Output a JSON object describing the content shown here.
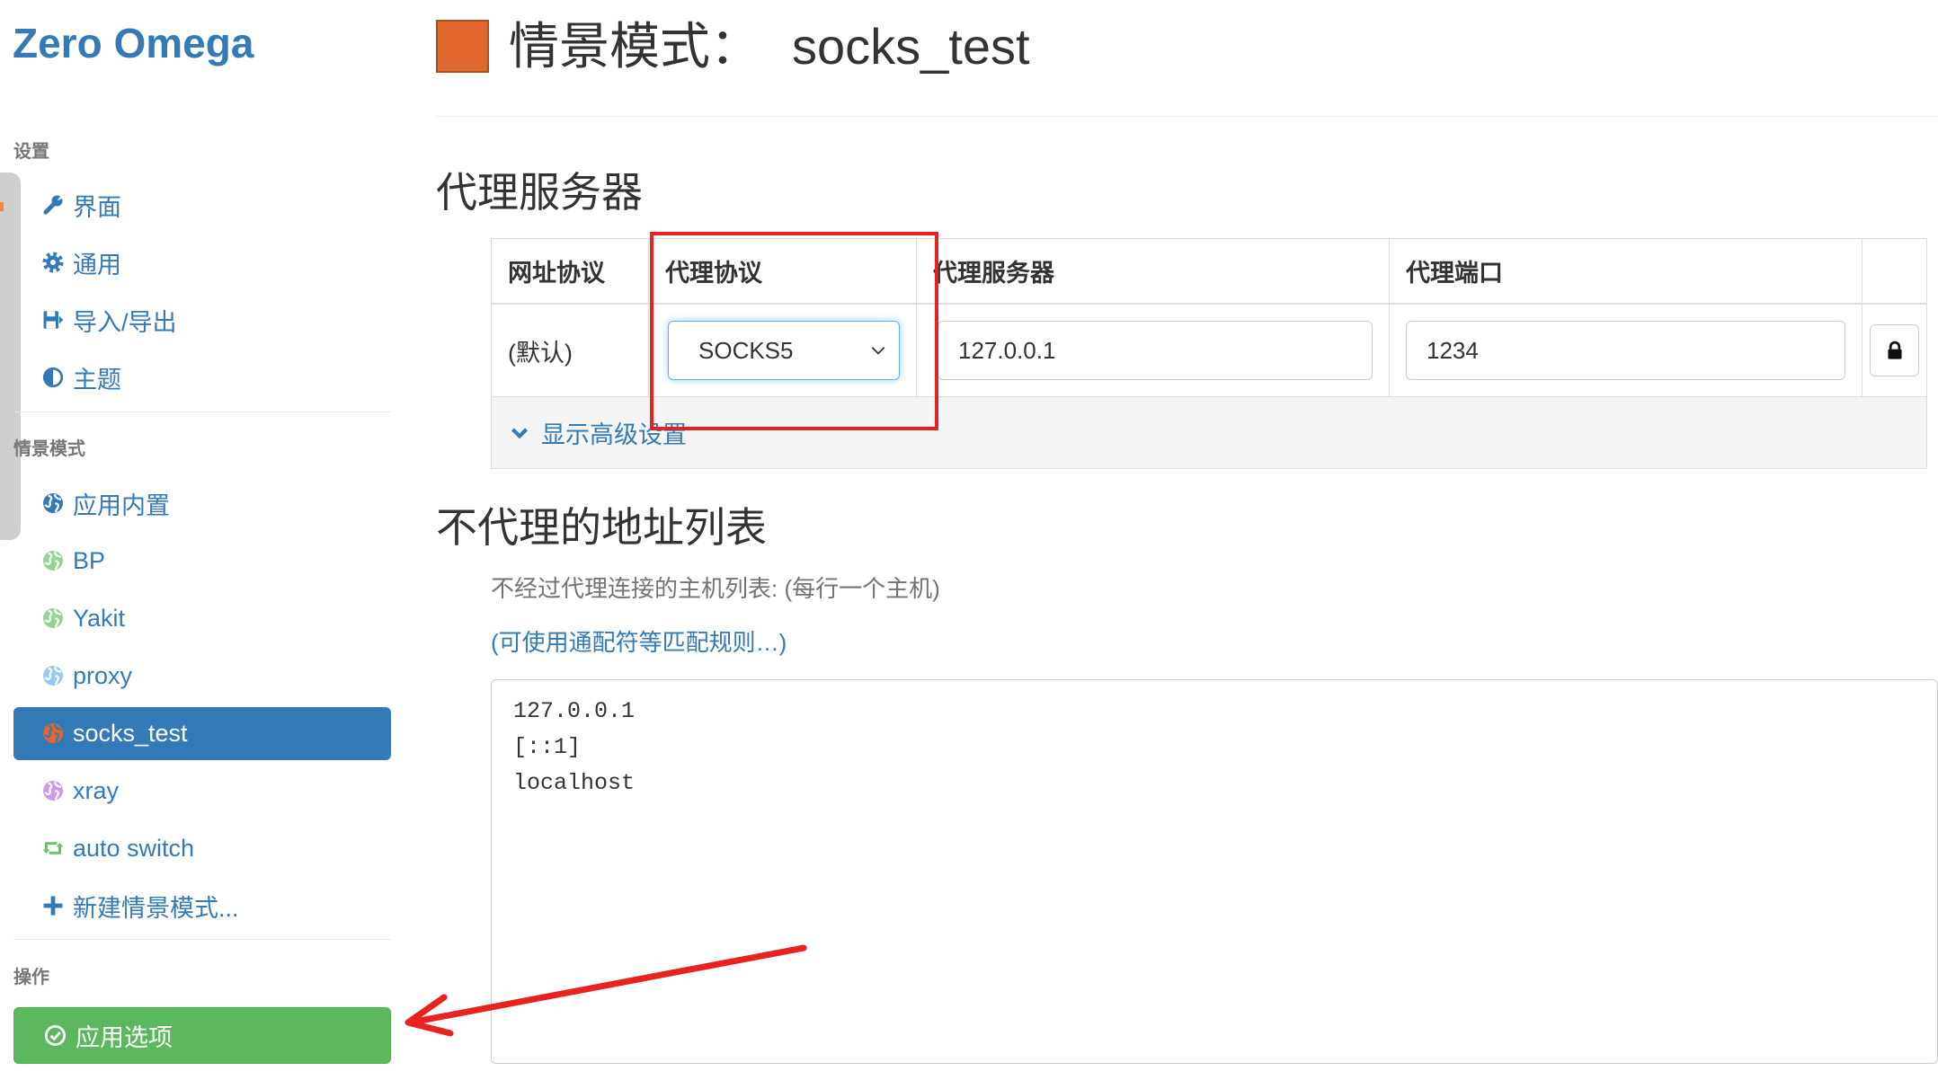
{
  "app": {
    "brand": "Zero Omega"
  },
  "sidebar": {
    "settings_header": "设置",
    "settings_items": [
      {
        "label": "界面",
        "icon": "wrench-icon"
      },
      {
        "label": "通用",
        "icon": "gear-icon"
      },
      {
        "label": "导入/导出",
        "icon": "floppy-disk-icon"
      },
      {
        "label": "主题",
        "icon": "contrast-icon"
      }
    ],
    "profiles_header": "情景模式",
    "profiles": [
      {
        "label": "应用内置",
        "icon": "globe-icon",
        "icon_color": "#337ab7"
      },
      {
        "label": "BP",
        "icon": "globe-icon",
        "icon_color": "#93d393"
      },
      {
        "label": "Yakit",
        "icon": "globe-icon",
        "icon_color": "#93d393"
      },
      {
        "label": "proxy",
        "icon": "globe-icon",
        "icon_color": "#99c9f0"
      },
      {
        "label": "socks_test",
        "icon": "globe-icon",
        "icon_color": "#e2672f",
        "active": true
      },
      {
        "label": "xray",
        "icon": "globe-icon",
        "icon_color": "#c99be8"
      },
      {
        "label": "auto switch",
        "icon": "retweet-icon",
        "icon_color": "#6cc26c"
      }
    ],
    "new_profile": {
      "label": "新建情景模式...",
      "icon": "plus-icon"
    },
    "actions_header": "操作",
    "apply_button": {
      "label": "应用选项",
      "icon": "ok-circle-icon",
      "color": "#5cb85c"
    }
  },
  "page": {
    "title_label": "情景模式：",
    "profile_name": "socks_test",
    "profile_color": "#e2672f",
    "proxy_section_title": "代理服务器",
    "proxy_table": {
      "headers": [
        "网址协议",
        "代理协议",
        "代理服务器",
        "代理端口"
      ],
      "row": {
        "scheme": "(默认)",
        "protocol": "SOCKS5",
        "host": "127.0.0.1",
        "port": "1234"
      }
    },
    "advanced_link": "显示高级设置",
    "bypass_section_title": "不代理的地址列表",
    "bypass_help": "不经过代理连接的主机列表: (每行一个主机)",
    "bypass_rules_link": "(可使用通配符等匹配规则…)",
    "bypass_list": "127.0.0.1\n[::1]\nlocalhost"
  },
  "theme": {
    "link_color": "#337ab7",
    "annotation_color": "#e8231f"
  }
}
